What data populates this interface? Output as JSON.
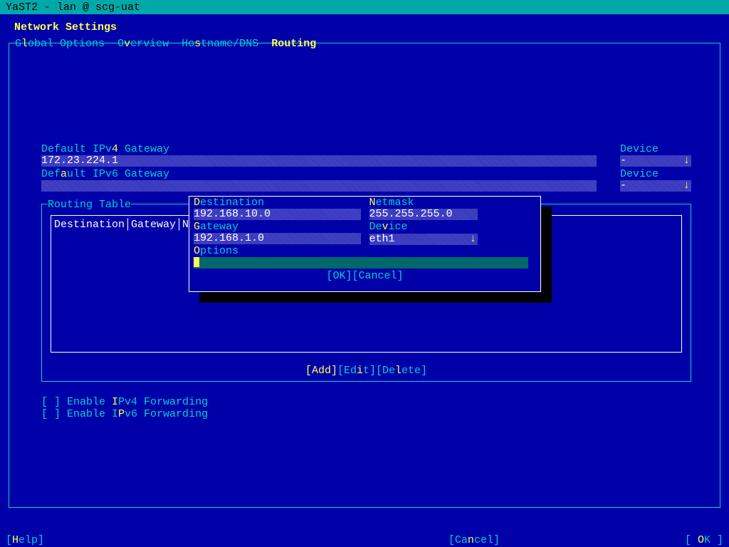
{
  "titlebar": "YaST2 - lan @ scg-uat",
  "page_title": "Network Settings",
  "tabs": {
    "global_pre": "G",
    "global_hot": "l",
    "global_post": "obal Options",
    "overview_pre": "O",
    "overview_hot": "v",
    "overview_post": "erview",
    "hostname_pre": "Ho",
    "hostname_hot": "s",
    "hostname_post": "tname/DNS",
    "routing_pre": "Ro",
    "routing_hot": "u",
    "routing_post": "ting"
  },
  "ipv4": {
    "label_pre": "Default IPv",
    "label_hot": "4",
    "label_post": " Gateway",
    "value": "172.23.224.1",
    "device_label": "Device",
    "device_value": "-"
  },
  "ipv6": {
    "label_pre": "Def",
    "label_hot": "a",
    "label_post": "ult IPv6 Gateway",
    "value": "",
    "device_label": "Device",
    "device_value": "-"
  },
  "routing": {
    "title": "Routing Table",
    "headers": "Destination│Gateway│Net"
  },
  "dialog": {
    "dest_pre": "",
    "dest_hot": "D",
    "dest_post": "estination",
    "dest_val": "192.168.10.0",
    "netmask_pre": "",
    "netmask_hot": "N",
    "netmask_post": "etmask",
    "netmask_val": "255.255.255.0",
    "gateway_pre": "",
    "gateway_hot": "G",
    "gateway_post": "ateway",
    "gateway_val": "192.168.1.0",
    "device_pre": "De",
    "device_hot": "v",
    "device_post": "ice",
    "device_val": "eth1",
    "options_pre": "",
    "options_hot": "O",
    "options_post": "ptions",
    "ok": "[OK]",
    "cancel": "[Cancel]"
  },
  "frame_buttons": {
    "add_pre": "[",
    "add_hot": "A",
    "add_post": "dd]",
    "edit_pre": "[Ed",
    "edit_hot": "i",
    "edit_post": "t]",
    "delete_pre": "[De",
    "delete_hot": "l",
    "delete_post": "ete]"
  },
  "checks": {
    "ipv4_pre": "[ ] Enable ",
    "ipv4_hot": "I",
    "ipv4_post": "Pv4 Forwarding",
    "ipv6_pre": "[ ] Enable I",
    "ipv6_hot": "P",
    "ipv6_post": "v6 Forwarding"
  },
  "footer": {
    "help_pre": "[",
    "help_hot": "H",
    "help_post": "elp]",
    "cancel_pre": "[Ca",
    "cancel_hot": "n",
    "cancel_post": "cel]",
    "ok_pre": "[ ",
    "ok_hot": "O",
    "ok_post": "K ]"
  }
}
